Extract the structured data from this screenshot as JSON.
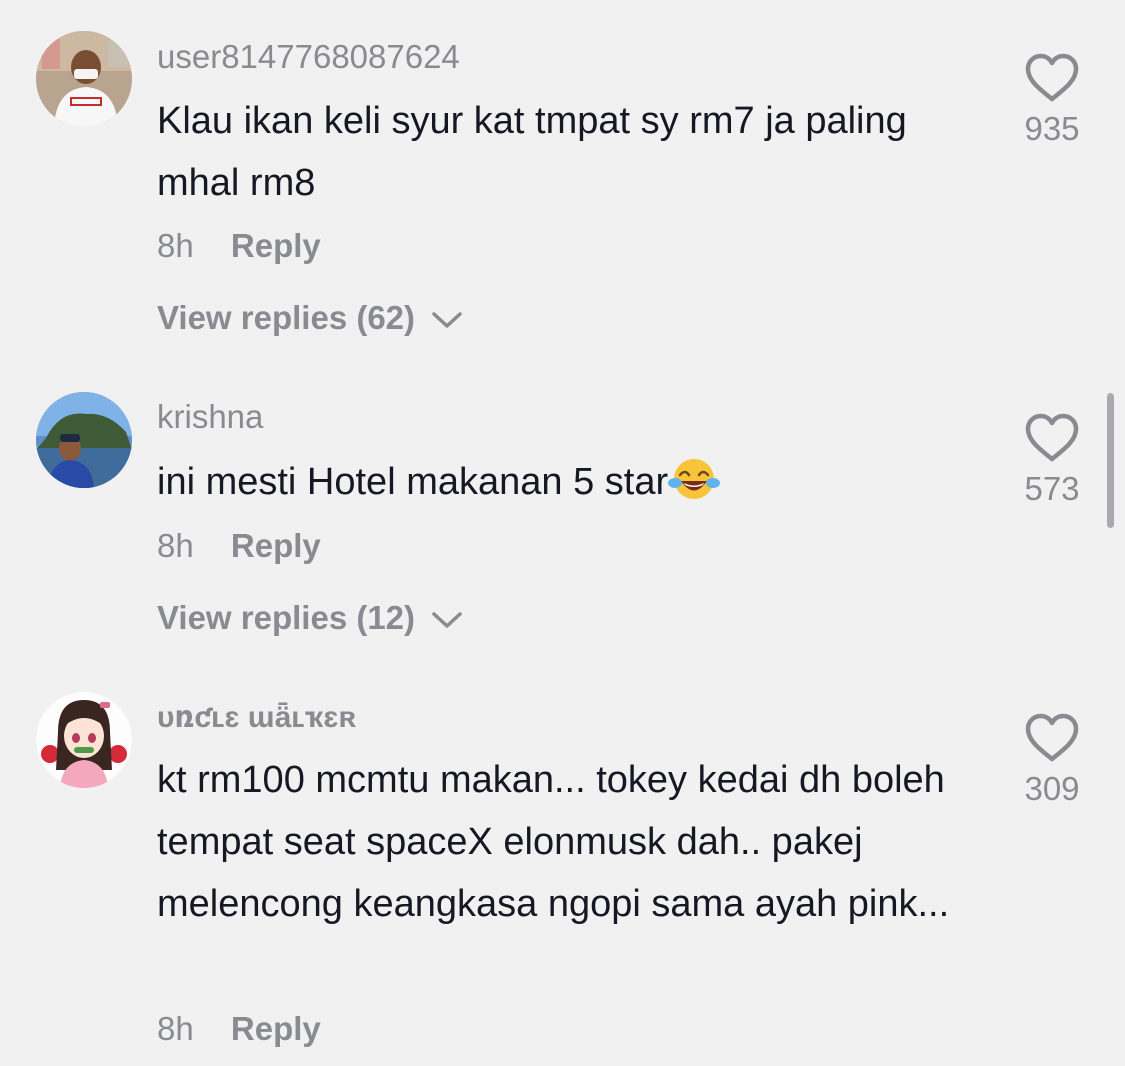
{
  "comments": [
    {
      "username": "user8147768087624",
      "text": "Klau ikan keli syur kat tmpat sy rm7 ja paling mhal rm8",
      "time": "8h",
      "reply_label": "Reply",
      "view_replies": "View replies (62)",
      "likes": "935",
      "avatar_icon": "user-avatar-photo"
    },
    {
      "username": "krishna",
      "text": "ini mesti Hotel makanan 5 star",
      "time": "8h",
      "reply_label": "Reply",
      "view_replies": "View replies (12)",
      "likes": "573",
      "avatar_icon": "user-avatar-photo",
      "emoji": "face-with-tears-of-joy"
    },
    {
      "username": "ᴜռƈʟɛ ɯǟʟҡɛʀ",
      "text": "kt rm100 mcmtu makan... tokey kedai dh boleh tempat seat spaceX elonmusk dah.. pakej melencong keangkasa ngopi sama ayah pink...",
      "time": "8h",
      "reply_label": "Reply",
      "likes": "309",
      "avatar_icon": "user-avatar-anime"
    }
  ],
  "colors": {
    "background": "#f1f1f2",
    "primary_text": "#161823",
    "secondary_text": "#8a8b91",
    "scrollbar": "#a9aaae"
  }
}
